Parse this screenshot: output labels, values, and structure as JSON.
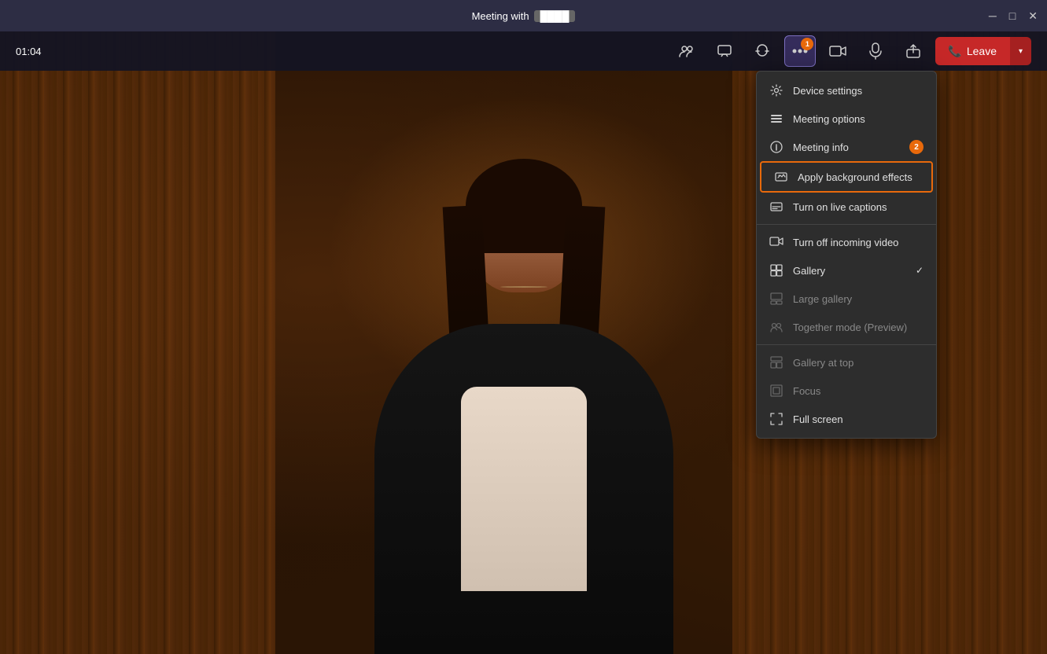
{
  "titleBar": {
    "title": "Meeting with",
    "blurred": "████████",
    "controls": {
      "minimize": "─",
      "maximize": "□",
      "close": "✕"
    }
  },
  "toolbar": {
    "timer": "01:04",
    "buttons": {
      "participants": "👥",
      "chat": "💬",
      "react": "👋",
      "more": "···",
      "more_badge": "1",
      "camera": "📹",
      "mic": "🎙",
      "share": "⬆",
      "leave": "Leave"
    }
  },
  "dropdown": {
    "items": [
      {
        "id": "device-settings",
        "label": "Device settings",
        "icon": "⚙",
        "disabled": false,
        "check": false,
        "badge": null,
        "highlighted": false
      },
      {
        "id": "meeting-options",
        "label": "Meeting options",
        "icon": "≡",
        "disabled": false,
        "check": false,
        "badge": null,
        "highlighted": false
      },
      {
        "id": "meeting-info",
        "label": "Meeting info",
        "icon": "ℹ",
        "disabled": false,
        "check": false,
        "badge": "2",
        "highlighted": false
      },
      {
        "id": "apply-background",
        "label": "Apply background effects",
        "icon": "✦",
        "disabled": false,
        "check": false,
        "badge": null,
        "highlighted": true
      },
      {
        "id": "live-captions",
        "label": "Turn on live captions",
        "icon": "💬",
        "disabled": false,
        "check": false,
        "badge": null,
        "highlighted": false
      },
      {
        "divider": true
      },
      {
        "id": "turn-off-video",
        "label": "Turn off incoming video",
        "icon": "📹",
        "disabled": false,
        "check": false,
        "badge": null,
        "highlighted": false
      },
      {
        "id": "gallery",
        "label": "Gallery",
        "icon": "⊞",
        "disabled": false,
        "check": true,
        "badge": null,
        "highlighted": false
      },
      {
        "id": "large-gallery",
        "label": "Large gallery",
        "icon": "⊟",
        "disabled": true,
        "check": false,
        "badge": null,
        "highlighted": false
      },
      {
        "id": "together-mode",
        "label": "Together mode (Preview)",
        "icon": "👥",
        "disabled": true,
        "check": false,
        "badge": null,
        "highlighted": false
      },
      {
        "divider2": true
      },
      {
        "id": "gallery-top",
        "label": "Gallery at top",
        "icon": "⊡",
        "disabled": true,
        "check": false,
        "badge": null,
        "highlighted": false
      },
      {
        "id": "focus",
        "label": "Focus",
        "icon": "⊞",
        "disabled": true,
        "check": false,
        "badge": null,
        "highlighted": false
      },
      {
        "id": "full-screen",
        "label": "Full screen",
        "icon": "⊞",
        "disabled": false,
        "check": false,
        "badge": null,
        "highlighted": false
      }
    ]
  }
}
